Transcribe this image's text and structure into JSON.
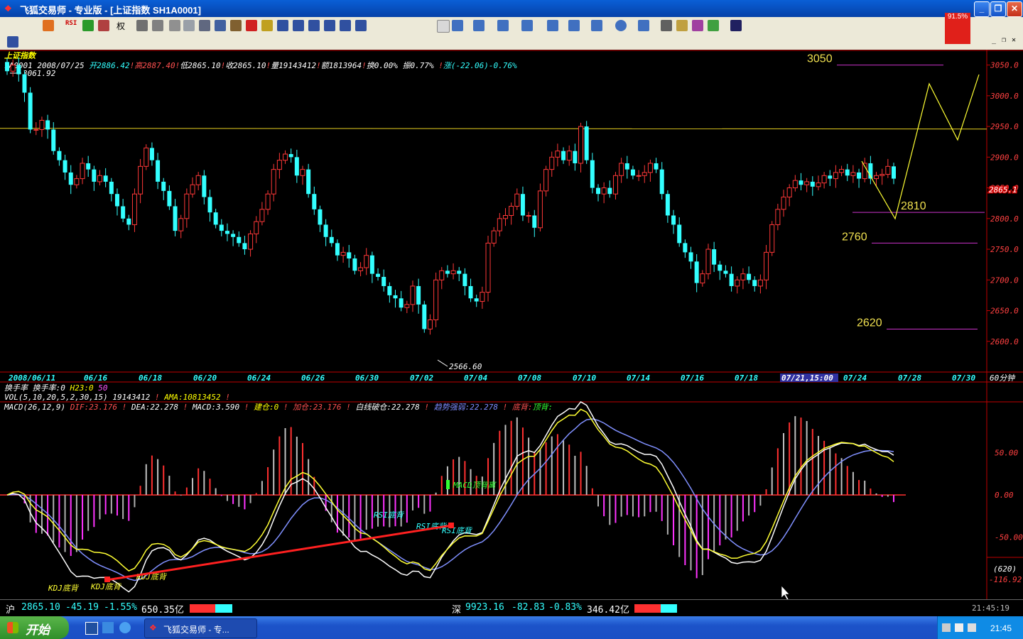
{
  "window": {
    "title": "飞狐交易师 - 专业版 - [上证指数  SH1A0001]",
    "badge": "91.5%"
  },
  "toolbar": {
    "rsi_label": "RSI",
    "quan_label": "权"
  },
  "info": {
    "index_name": "上证指数",
    "ohlc_line": [
      {
        "text": "1A0001",
        "color": "#ffffff"
      },
      {
        "text": " 2008/07/25 ",
        "color": "#ffffff"
      },
      {
        "text": "开2886.42",
        "color": "#33ffff"
      },
      {
        "text": "!",
        "color": "#ff5050"
      },
      {
        "text": "高2887.40",
        "color": "#ff5050"
      },
      {
        "text": "!",
        "color": "#ff5050"
      },
      {
        "text": "低2865.10",
        "color": "#ffffff"
      },
      {
        "text": "!",
        "color": "#ff5050"
      },
      {
        "text": "收2865.10",
        "color": "#ffffff"
      },
      {
        "text": "!",
        "color": "#ff5050"
      },
      {
        "text": "量19143412",
        "color": "#ffffff"
      },
      {
        "text": "!",
        "color": "#ff5050"
      },
      {
        "text": "额1813964",
        "color": "#ffffff"
      },
      {
        "text": "!",
        "color": "#ff5050"
      },
      {
        "text": "换0.00%",
        "color": "#ffffff"
      },
      {
        "text": " 振0.77% ",
        "color": "#ffffff"
      },
      {
        "text": "!",
        "color": "#ff5050"
      },
      {
        "text": "涨(-22.06)-0.76%",
        "color": "#33ffff"
      }
    ],
    "high_label": "3061.92",
    "low_label": "2566.60",
    "turnover_line": [
      {
        "text": "换手率  换手率:0 ",
        "color": "#ffffff"
      },
      {
        "text": "H23:0 ",
        "color": "#ffff00"
      },
      {
        "text": "50",
        "color": "#ff55ff"
      }
    ],
    "vol_line": [
      {
        "text": "VOL(5,10,20,5,2,30,15) ",
        "color": "#ffffff"
      },
      {
        "text": "19143412",
        "color": "#ffffff"
      },
      {
        "text": " ! ",
        "color": "#ff5050"
      },
      {
        "text": "AMA:10813452",
        "color": "#ffff00"
      },
      {
        "text": " !",
        "color": "#ff5050"
      }
    ],
    "macd_line": [
      {
        "text": "MACD(26,12,9) ",
        "color": "#ffffff"
      },
      {
        "text": "DIF:23.176",
        "color": "#ff5050"
      },
      {
        "text": " ! ",
        "color": "#ff5050"
      },
      {
        "text": "DEA:22.278",
        "color": "#ffffff"
      },
      {
        "text": " ! ",
        "color": "#ff5050"
      },
      {
        "text": "MACD:3.590",
        "color": "#ffffff"
      },
      {
        "text": " ! ",
        "color": "#ff5050"
      },
      {
        "text": "建仓:0",
        "color": "#ffff00"
      },
      {
        "text": " ! ",
        "color": "#ff5050"
      },
      {
        "text": "加仓:23.176",
        "color": "#ff5050"
      },
      {
        "text": " ! ",
        "color": "#ff5050"
      },
      {
        "text": "白线破仓:22.278",
        "color": "#ffffff"
      },
      {
        "text": " ! ",
        "color": "#ff5050"
      },
      {
        "text": "趋势强弱:22.278",
        "color": "#7f8cff"
      },
      {
        "text": " ! ",
        "color": "#ff5050"
      },
      {
        "text": "底背:",
        "color": "#ff5050"
      },
      {
        "text": "顶背:",
        "color": "#33ff33"
      }
    ],
    "period": "60分钟",
    "cursor_date": "07/21,15:00"
  },
  "chart_data": {
    "type": "candlestick",
    "title": "上证指数",
    "ylim": [
      2550,
      3075
    ],
    "yticks": [
      2600,
      2650,
      2700,
      2750,
      2800,
      2850,
      2900,
      2950,
      3000,
      3050
    ],
    "ytick_labels": [
      "2600.0",
      "2650.0",
      "2700.0",
      "2750.0",
      "2800.0",
      "2850.0",
      "2900.0",
      "2950.0",
      "3000.0",
      "3050.0"
    ],
    "x_labels": [
      "2008/06/11",
      "06/16",
      "06/18",
      "06/20",
      "06/24",
      "06/26",
      "06/30",
      "07/02",
      "07/04",
      "07/08",
      "07/10",
      "07/14",
      "07/16",
      "07/18",
      "07/21,15:00",
      "07/24",
      "07/28",
      "07/30"
    ],
    "last_price_label": "2865.1",
    "closes": [
      3040,
      3050,
      3035,
      3005,
      2945,
      2945,
      2960,
      2945,
      2910,
      2895,
      2875,
      2855,
      2865,
      2890,
      2880,
      2860,
      2870,
      2860,
      2840,
      2820,
      2800,
      2790,
      2840,
      2885,
      2915,
      2895,
      2860,
      2845,
      2820,
      2780,
      2800,
      2840,
      2855,
      2870,
      2835,
      2810,
      2790,
      2780,
      2775,
      2770,
      2760,
      2750,
      2775,
      2795,
      2815,
      2840,
      2880,
      2895,
      2905,
      2900,
      2870,
      2880,
      2840,
      2815,
      2790,
      2770,
      2760,
      2740,
      2745,
      2735,
      2715,
      2720,
      2740,
      2710,
      2705,
      2690,
      2675,
      2670,
      2655,
      2660,
      2690,
      2660,
      2620,
      2635,
      2700,
      2715,
      2710,
      2715,
      2710,
      2690,
      2670,
      2665,
      2680,
      2760,
      2780,
      2800,
      2805,
      2820,
      2840,
      2805,
      2805,
      2785,
      2845,
      2880,
      2900,
      2910,
      2895,
      2910,
      2890,
      2950,
      2895,
      2850,
      2840,
      2850,
      2840,
      2870,
      2890,
      2880,
      2870,
      2870,
      2875,
      2890,
      2880,
      2840,
      2805,
      2790,
      2760,
      2745,
      2730,
      2695,
      2710,
      2750,
      2725,
      2715,
      2710,
      2690,
      2700,
      2710,
      2700,
      2690,
      2700,
      2745,
      2790,
      2815,
      2835,
      2850,
      2862,
      2855,
      2860,
      2852,
      2858,
      2870,
      2865,
      2875,
      2880,
      2870,
      2875,
      2865,
      2890,
      2865,
      2870,
      2872,
      2885,
      2865
    ],
    "annotations": {
      "levels": [
        {
          "label": "3050",
          "value": 3050
        },
        {
          "label": "2810",
          "value": 2810
        },
        {
          "label": "2760",
          "value": 2760
        },
        {
          "label": "2620",
          "value": 2620
        }
      ],
      "resistance_value": 2947
    },
    "volume_macd": {
      "ylim": [
        -120,
        100
      ],
      "ytick_labels": [
        "50.00",
        "0.00",
        "-50.00"
      ],
      "yticks": [
        50,
        0,
        -50
      ],
      "current_label": "(620)",
      "min_label": "-116.92",
      "signal_labels": [
        "KDJ底背",
        "KDJ底背",
        "KDJ底背",
        "RSI底背",
        "RSI底背",
        "RSI底背",
        "MACD顶背离"
      ]
    }
  },
  "statusbar": {
    "sh_label": "沪",
    "sh_price": "2865.10",
    "sh_change": "-45.19",
    "sh_pct": "-1.55%",
    "sh_amount": "650.35亿",
    "sz_label": "深",
    "sz_price": "9923.16",
    "sz_change": "-82.83",
    "sz_pct": "-0.83%",
    "sz_amount": "346.42亿",
    "clock": "21:45:19"
  },
  "taskbar": {
    "start_label": "开始",
    "task_label": "飞狐交易师 - 专...",
    "time": "21:45"
  }
}
